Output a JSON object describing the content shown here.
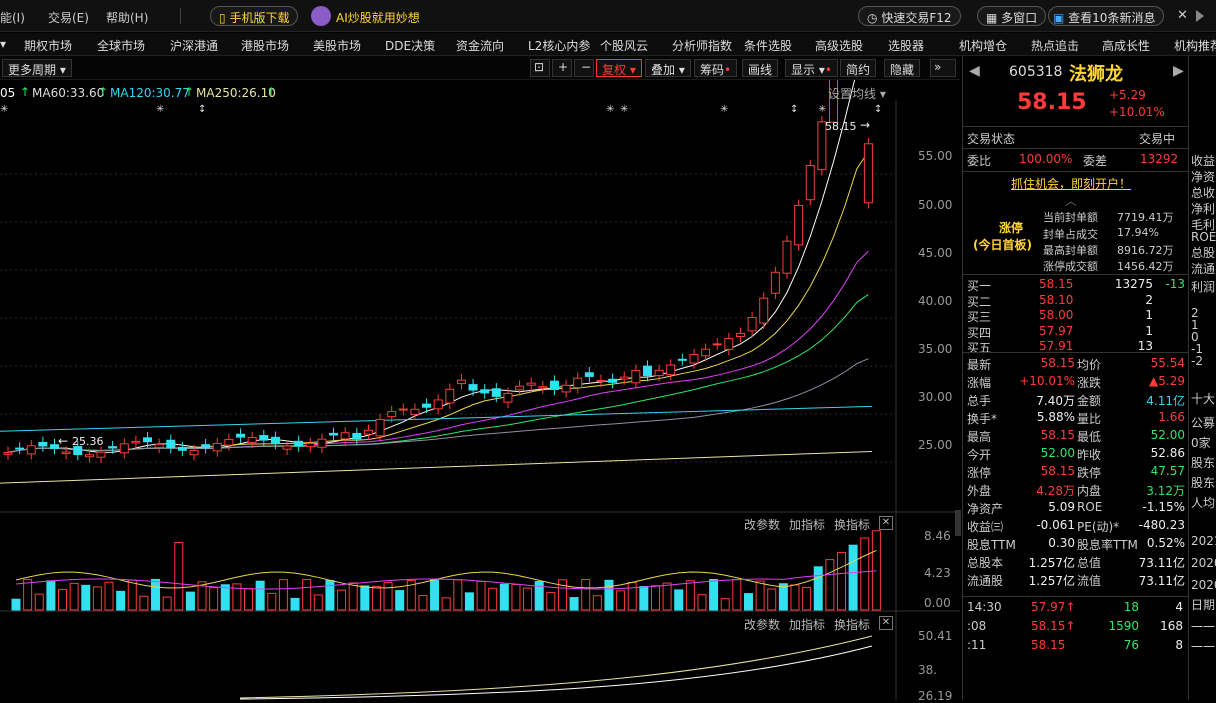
{
  "menu": {
    "items": [
      "能(I)",
      "交易(E)",
      "帮助(H)"
    ],
    "mobile_download": "手机版下载",
    "ai_label": "AI炒股就用妙想",
    "quick_trade": "快速交易F12",
    "multi_window": "多窗口",
    "news_label": "查看10条新消息",
    "close": "✕"
  },
  "nav": {
    "items": [
      "期权市场",
      "全球市场",
      "沪深港通",
      "港股市场",
      "美股市场",
      "DDE决策",
      "资金流向",
      "L2核心内参",
      "个股风云",
      "分析师指数",
      "条件选股",
      "高级选股",
      "选股器",
      "机构增仓",
      "热点追击",
      "高成长性",
      "机构推荐"
    ]
  },
  "toolbar": {
    "period": "更多周期",
    "fuquan": "复权",
    "overlay": "叠加",
    "chips": "筹码",
    "drawline": "画线",
    "display": "显示",
    "simple": "简约",
    "hide": "隐藏"
  },
  "ma_legend": {
    "ma60": "MA60:33.60",
    "ma120": "MA120:30.77",
    "ma250": "MA250:26.10",
    "prefix": "05",
    "setting": "设置均线"
  },
  "main_axis": {
    "ticks": [
      "55.00",
      "50.00",
      "45.00",
      "40.00",
      "35.00",
      "30.00",
      "25.00"
    ]
  },
  "main_labels": {
    "high": "58.15",
    "low": "25.36"
  },
  "vol_panel": {
    "params": "改参数",
    "add": "加指标",
    "switch": "换指标",
    "ticks": [
      "8.46",
      "4.23",
      "0.00"
    ]
  },
  "third_panel": {
    "params": "改参数",
    "add": "加指标",
    "switch": "换指标",
    "ticks": [
      "50.41",
      "38.",
      "26.19"
    ]
  },
  "stock": {
    "code": "605318",
    "name": "法狮龙",
    "price": "58.15",
    "change": "+5.29",
    "change_pct": "+10.01%",
    "trade_status_label": "交易状态",
    "trade_status": "交易中",
    "weibi_label": "委比",
    "weibi": "100.00%",
    "weicha_label": "委差",
    "weicha": "13292",
    "open_account": "抓住机会，即刻开户！",
    "limit_up_title": "涨停",
    "limit_up_sub": "(今日首板)",
    "limit_info": [
      {
        "label": "当前封单额",
        "value": "7719.41万"
      },
      {
        "label": "封单占成交",
        "value": "17.94%"
      },
      {
        "label": "最高封单额",
        "value": "8916.72万"
      },
      {
        "label": "涨停成交额",
        "value": "1456.42万"
      }
    ],
    "bids": [
      {
        "label": "买一",
        "price": "58.15",
        "vol": "13275",
        "chg": "-13"
      },
      {
        "label": "买二",
        "price": "58.10",
        "vol": "2",
        "chg": ""
      },
      {
        "label": "买三",
        "price": "58.00",
        "vol": "1",
        "chg": ""
      },
      {
        "label": "买四",
        "price": "57.97",
        "vol": "1",
        "chg": ""
      },
      {
        "label": "买五",
        "price": "57.91",
        "vol": "13",
        "chg": ""
      }
    ],
    "stats": [
      {
        "l1": "最新",
        "v1": "58.15",
        "c1": "red",
        "l2": "均价",
        "v2": "55.54",
        "c2": "red"
      },
      {
        "l1": "涨幅",
        "v1": "+10.01%",
        "c1": "red",
        "l2": "涨跌",
        "v2": "▲5.29",
        "c2": "red"
      },
      {
        "l1": "总手",
        "v1": "7.40万",
        "c1": "white",
        "l2": "金额",
        "v2": "4.11亿",
        "c2": "cyan"
      },
      {
        "l1": "换手*",
        "v1": "5.88%",
        "c1": "white",
        "l2": "量比",
        "v2": "1.66",
        "c2": "red"
      },
      {
        "l1": "最高",
        "v1": "58.15",
        "c1": "red",
        "l2": "最低",
        "v2": "52.00",
        "c2": "green"
      },
      {
        "l1": "今开",
        "v1": "52.00",
        "c1": "green",
        "l2": "昨收",
        "v2": "52.86",
        "c2": "white"
      },
      {
        "l1": "涨停",
        "v1": "58.15",
        "c1": "red",
        "l2": "跌停",
        "v2": "47.57",
        "c2": "green"
      },
      {
        "l1": "外盘",
        "v1": "4.28万",
        "c1": "red",
        "l2": "内盘",
        "v2": "3.12万",
        "c2": "green"
      },
      {
        "l1": "净资产",
        "v1": "5.09",
        "c1": "white",
        "l2": "ROE",
        "v2": "-1.15%",
        "c2": "white"
      },
      {
        "l1": "收益㈢",
        "v1": "-0.061",
        "c1": "white",
        "l2": "PE(动)*",
        "v2": "-480.23",
        "c2": "white"
      },
      {
        "l1": "股息TTM",
        "v1": "0.30",
        "c1": "white",
        "l2": "股息率TTM",
        "v2": "0.52%",
        "c2": "white"
      },
      {
        "l1": "总股本",
        "v1": "1.257亿",
        "c1": "white",
        "l2": "总值",
        "v2": "73.11亿",
        "c2": "white"
      },
      {
        "l1": "流通股",
        "v1": "1.257亿",
        "c1": "white",
        "l2": "流值",
        "v2": "73.11亿",
        "c2": "white"
      }
    ],
    "ticks": [
      {
        "time": "14:30",
        "price": "57.97↑",
        "vol": "18",
        "cnt": "4"
      },
      {
        "time": ":08",
        "price": "58.15↑",
        "vol": "1590",
        "cnt": "168"
      },
      {
        "time": ":11",
        "price": "58.15",
        "vol": "76",
        "cnt": "8"
      }
    ]
  },
  "far_right": [
    "收益",
    "净资",
    "总收",
    "净利",
    "毛利",
    "ROE",
    "总股",
    "流通",
    "利润",
    "2",
    "1",
    "0",
    "-1",
    "-2",
    "十大",
    "公募",
    "0家",
    "股东",
    "股东",
    "人均",
    "2021",
    "2020",
    "2020",
    "日期",
    "一一",
    "一一"
  ]
}
